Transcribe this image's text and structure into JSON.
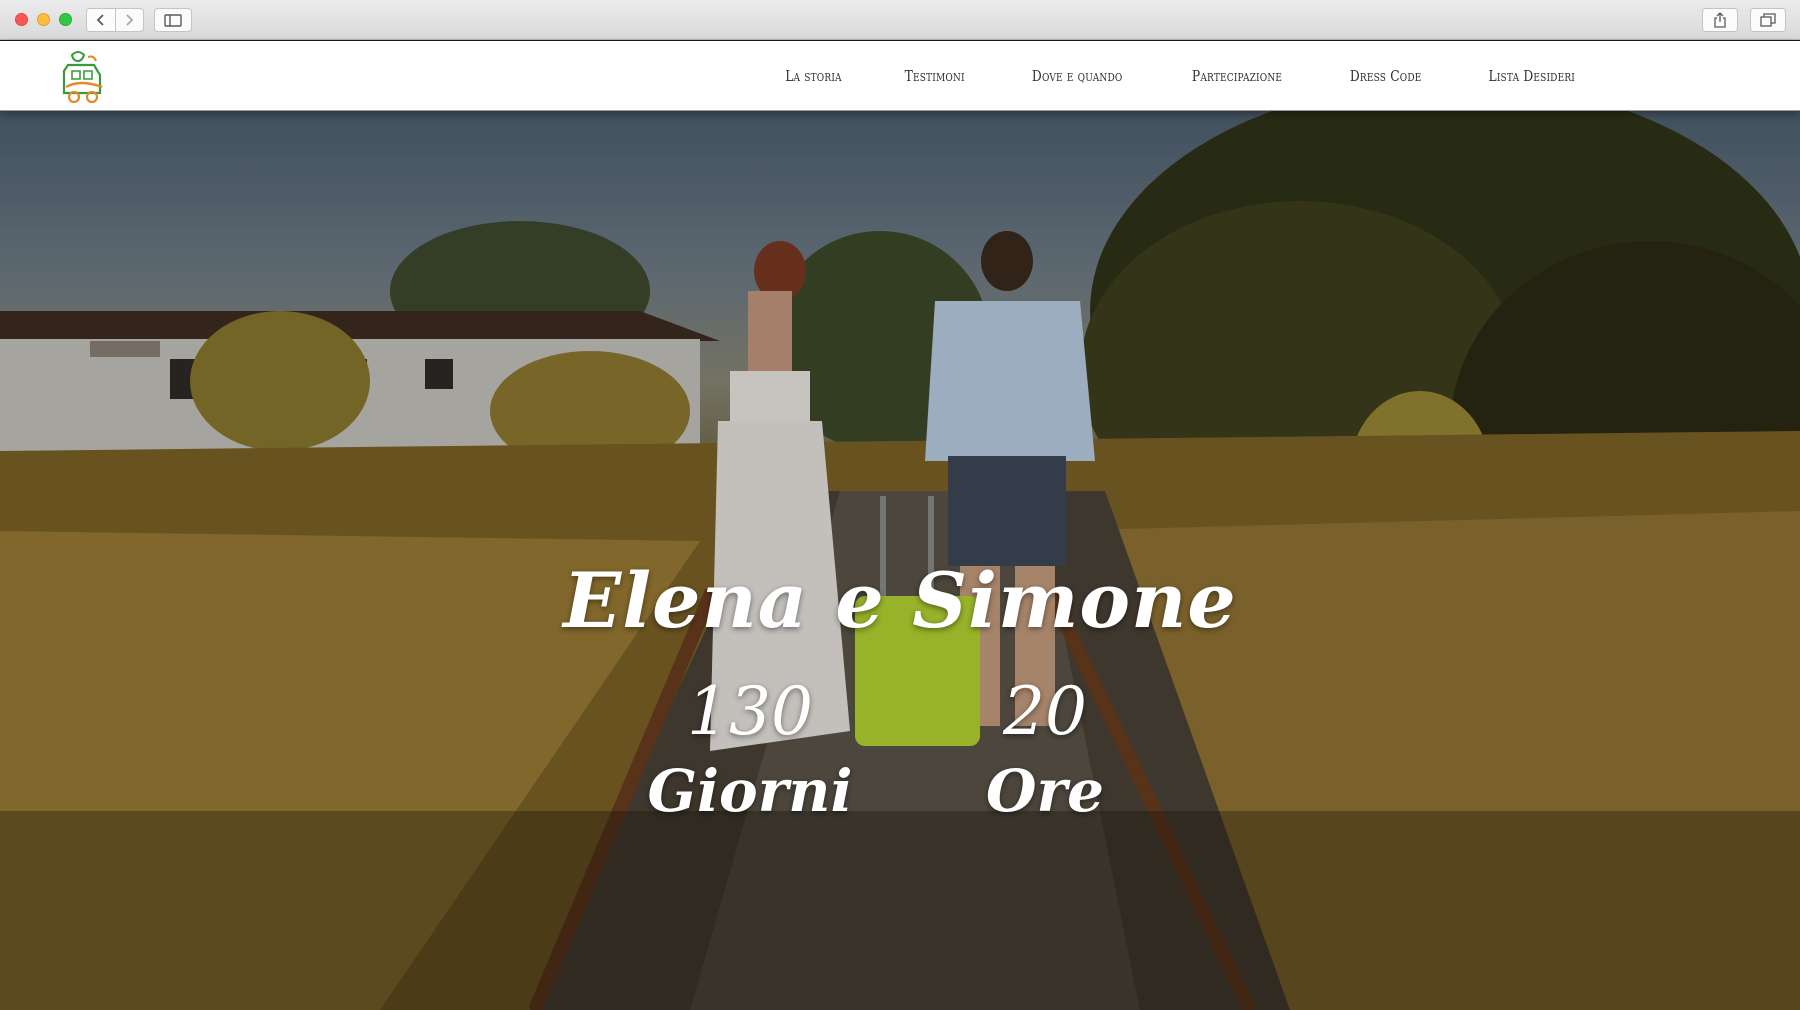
{
  "browser": {
    "buttons": [
      "back",
      "forward",
      "sidebar",
      "share",
      "tabs"
    ]
  },
  "header": {
    "logo_icon": "train-couple-logo-icon",
    "nav": [
      {
        "label": "La storia"
      },
      {
        "label": "Testimoni"
      },
      {
        "label": "Dove e quando"
      },
      {
        "label": "Partecipazione"
      },
      {
        "label": "Dress Code"
      },
      {
        "label": "Lista Desideri"
      }
    ]
  },
  "hero": {
    "title": "Elena e Simone",
    "countdown": {
      "days_value": "130",
      "days_label": "Giorni",
      "hours_value": "20",
      "hours_label": "Ore"
    }
  },
  "colors": {
    "logo_green": "#3a9a3a",
    "logo_orange": "#e08a2a",
    "suitcase": "#b8d832",
    "header_bg": "#ffffff",
    "nav_text": "#2f2f2f"
  }
}
